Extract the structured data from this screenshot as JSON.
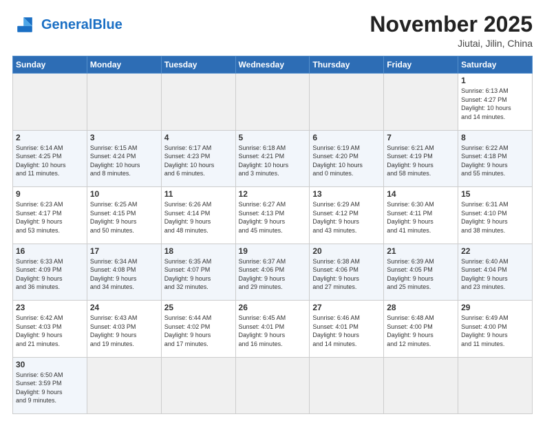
{
  "logo": {
    "general": "General",
    "blue": "Blue"
  },
  "header": {
    "month": "November 2025",
    "location": "Jiutai, Jilin, China"
  },
  "weekdays": [
    "Sunday",
    "Monday",
    "Tuesday",
    "Wednesday",
    "Thursday",
    "Friday",
    "Saturday"
  ],
  "days": [
    {
      "num": "",
      "info": ""
    },
    {
      "num": "",
      "info": ""
    },
    {
      "num": "",
      "info": ""
    },
    {
      "num": "",
      "info": ""
    },
    {
      "num": "",
      "info": ""
    },
    {
      "num": "",
      "info": ""
    },
    {
      "num": "1",
      "info": "Sunrise: 6:13 AM\nSunset: 4:27 PM\nDaylight: 10 hours\nand 14 minutes."
    },
    {
      "num": "2",
      "info": "Sunrise: 6:14 AM\nSunset: 4:25 PM\nDaylight: 10 hours\nand 11 minutes."
    },
    {
      "num": "3",
      "info": "Sunrise: 6:15 AM\nSunset: 4:24 PM\nDaylight: 10 hours\nand 8 minutes."
    },
    {
      "num": "4",
      "info": "Sunrise: 6:17 AM\nSunset: 4:23 PM\nDaylight: 10 hours\nand 6 minutes."
    },
    {
      "num": "5",
      "info": "Sunrise: 6:18 AM\nSunset: 4:21 PM\nDaylight: 10 hours\nand 3 minutes."
    },
    {
      "num": "6",
      "info": "Sunrise: 6:19 AM\nSunset: 4:20 PM\nDaylight: 10 hours\nand 0 minutes."
    },
    {
      "num": "7",
      "info": "Sunrise: 6:21 AM\nSunset: 4:19 PM\nDaylight: 9 hours\nand 58 minutes."
    },
    {
      "num": "8",
      "info": "Sunrise: 6:22 AM\nSunset: 4:18 PM\nDaylight: 9 hours\nand 55 minutes."
    },
    {
      "num": "9",
      "info": "Sunrise: 6:23 AM\nSunset: 4:17 PM\nDaylight: 9 hours\nand 53 minutes."
    },
    {
      "num": "10",
      "info": "Sunrise: 6:25 AM\nSunset: 4:15 PM\nDaylight: 9 hours\nand 50 minutes."
    },
    {
      "num": "11",
      "info": "Sunrise: 6:26 AM\nSunset: 4:14 PM\nDaylight: 9 hours\nand 48 minutes."
    },
    {
      "num": "12",
      "info": "Sunrise: 6:27 AM\nSunset: 4:13 PM\nDaylight: 9 hours\nand 45 minutes."
    },
    {
      "num": "13",
      "info": "Sunrise: 6:29 AM\nSunset: 4:12 PM\nDaylight: 9 hours\nand 43 minutes."
    },
    {
      "num": "14",
      "info": "Sunrise: 6:30 AM\nSunset: 4:11 PM\nDaylight: 9 hours\nand 41 minutes."
    },
    {
      "num": "15",
      "info": "Sunrise: 6:31 AM\nSunset: 4:10 PM\nDaylight: 9 hours\nand 38 minutes."
    },
    {
      "num": "16",
      "info": "Sunrise: 6:33 AM\nSunset: 4:09 PM\nDaylight: 9 hours\nand 36 minutes."
    },
    {
      "num": "17",
      "info": "Sunrise: 6:34 AM\nSunset: 4:08 PM\nDaylight: 9 hours\nand 34 minutes."
    },
    {
      "num": "18",
      "info": "Sunrise: 6:35 AM\nSunset: 4:07 PM\nDaylight: 9 hours\nand 32 minutes."
    },
    {
      "num": "19",
      "info": "Sunrise: 6:37 AM\nSunset: 4:06 PM\nDaylight: 9 hours\nand 29 minutes."
    },
    {
      "num": "20",
      "info": "Sunrise: 6:38 AM\nSunset: 4:06 PM\nDaylight: 9 hours\nand 27 minutes."
    },
    {
      "num": "21",
      "info": "Sunrise: 6:39 AM\nSunset: 4:05 PM\nDaylight: 9 hours\nand 25 minutes."
    },
    {
      "num": "22",
      "info": "Sunrise: 6:40 AM\nSunset: 4:04 PM\nDaylight: 9 hours\nand 23 minutes."
    },
    {
      "num": "23",
      "info": "Sunrise: 6:42 AM\nSunset: 4:03 PM\nDaylight: 9 hours\nand 21 minutes."
    },
    {
      "num": "24",
      "info": "Sunrise: 6:43 AM\nSunset: 4:03 PM\nDaylight: 9 hours\nand 19 minutes."
    },
    {
      "num": "25",
      "info": "Sunrise: 6:44 AM\nSunset: 4:02 PM\nDaylight: 9 hours\nand 17 minutes."
    },
    {
      "num": "26",
      "info": "Sunrise: 6:45 AM\nSunset: 4:01 PM\nDaylight: 9 hours\nand 16 minutes."
    },
    {
      "num": "27",
      "info": "Sunrise: 6:46 AM\nSunset: 4:01 PM\nDaylight: 9 hours\nand 14 minutes."
    },
    {
      "num": "28",
      "info": "Sunrise: 6:48 AM\nSunset: 4:00 PM\nDaylight: 9 hours\nand 12 minutes."
    },
    {
      "num": "29",
      "info": "Sunrise: 6:49 AM\nSunset: 4:00 PM\nDaylight: 9 hours\nand 11 minutes."
    },
    {
      "num": "30",
      "info": "Sunrise: 6:50 AM\nSunset: 3:59 PM\nDaylight: 9 hours\nand 9 minutes."
    },
    {
      "num": "",
      "info": ""
    },
    {
      "num": "",
      "info": ""
    },
    {
      "num": "",
      "info": ""
    },
    {
      "num": "",
      "info": ""
    },
    {
      "num": "",
      "info": ""
    },
    {
      "num": "",
      "info": ""
    }
  ]
}
